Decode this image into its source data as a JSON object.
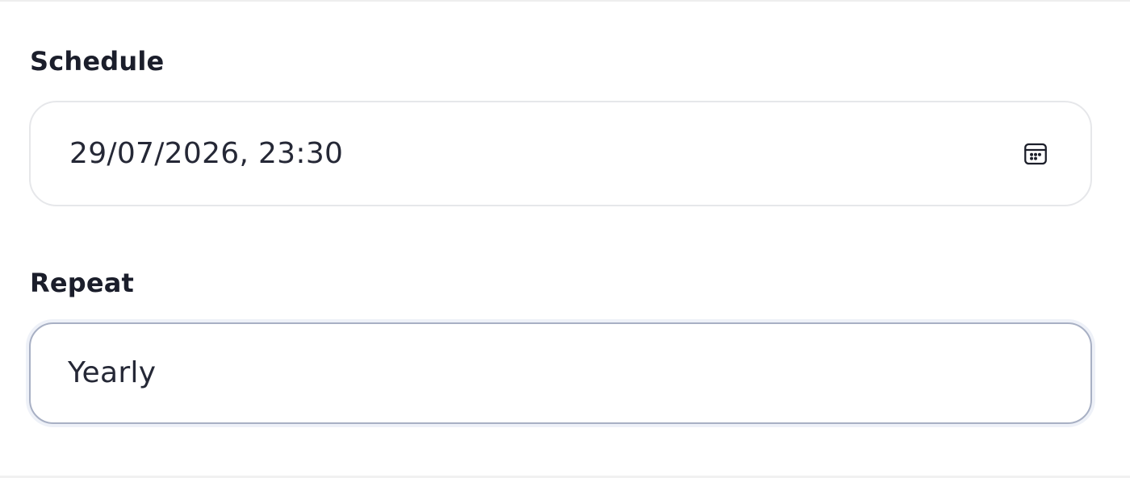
{
  "schedule": {
    "label": "Schedule",
    "value": "29/07/2026, 23:30",
    "icon": "calendar-icon"
  },
  "repeat": {
    "label": "Repeat",
    "value": "Yearly"
  }
}
